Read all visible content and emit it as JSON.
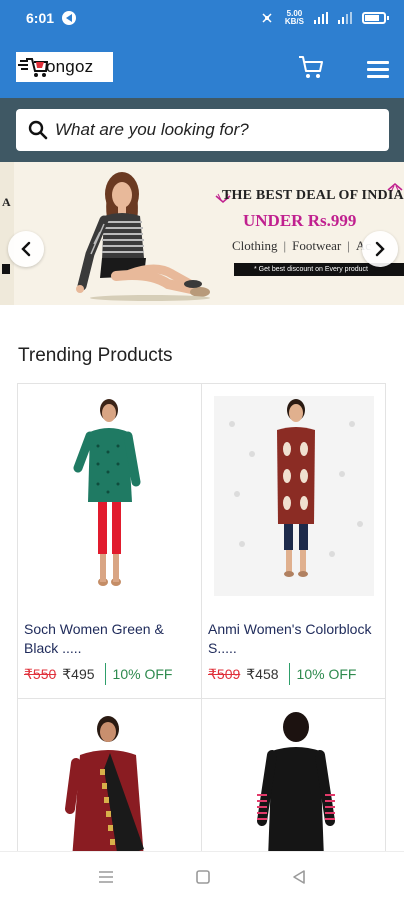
{
  "status_bar": {
    "time": "6:01",
    "speed_value": "5.00",
    "speed_unit": "KB/S",
    "network_labels": [
      "4G",
      "4G"
    ]
  },
  "header": {
    "logo_text": "ongoz",
    "brand_color": "#2e7fd0",
    "icons": [
      "cart-icon",
      "menu-icon"
    ]
  },
  "search": {
    "placeholder": "What are you looking for?"
  },
  "banner": {
    "left_peek_text": "A",
    "title": "THE BEST DEAL OF INDIA",
    "price_line": "UNDER Rs.999",
    "categories": [
      "Clothing",
      "Footwear",
      "Ac"
    ],
    "strip_text": "* Get best discount on Every product",
    "price_color": "#c0208f"
  },
  "trending": {
    "title": "Trending Products",
    "products": [
      {
        "name": "Soch Women Green & Black .....",
        "old_price": "₹550",
        "new_price": "₹495",
        "discount": "10% OFF"
      },
      {
        "name": "Anmi Women's Colorblock S.....",
        "old_price": "₹509",
        "new_price": "₹458",
        "discount": "10% OFF"
      },
      {
        "name": "",
        "old_price": "",
        "new_price": "",
        "discount": ""
      },
      {
        "name": "",
        "old_price": "",
        "new_price": "",
        "discount": ""
      }
    ]
  },
  "navigation": {
    "icons": [
      "recents-icon",
      "home-icon",
      "back-icon"
    ]
  }
}
